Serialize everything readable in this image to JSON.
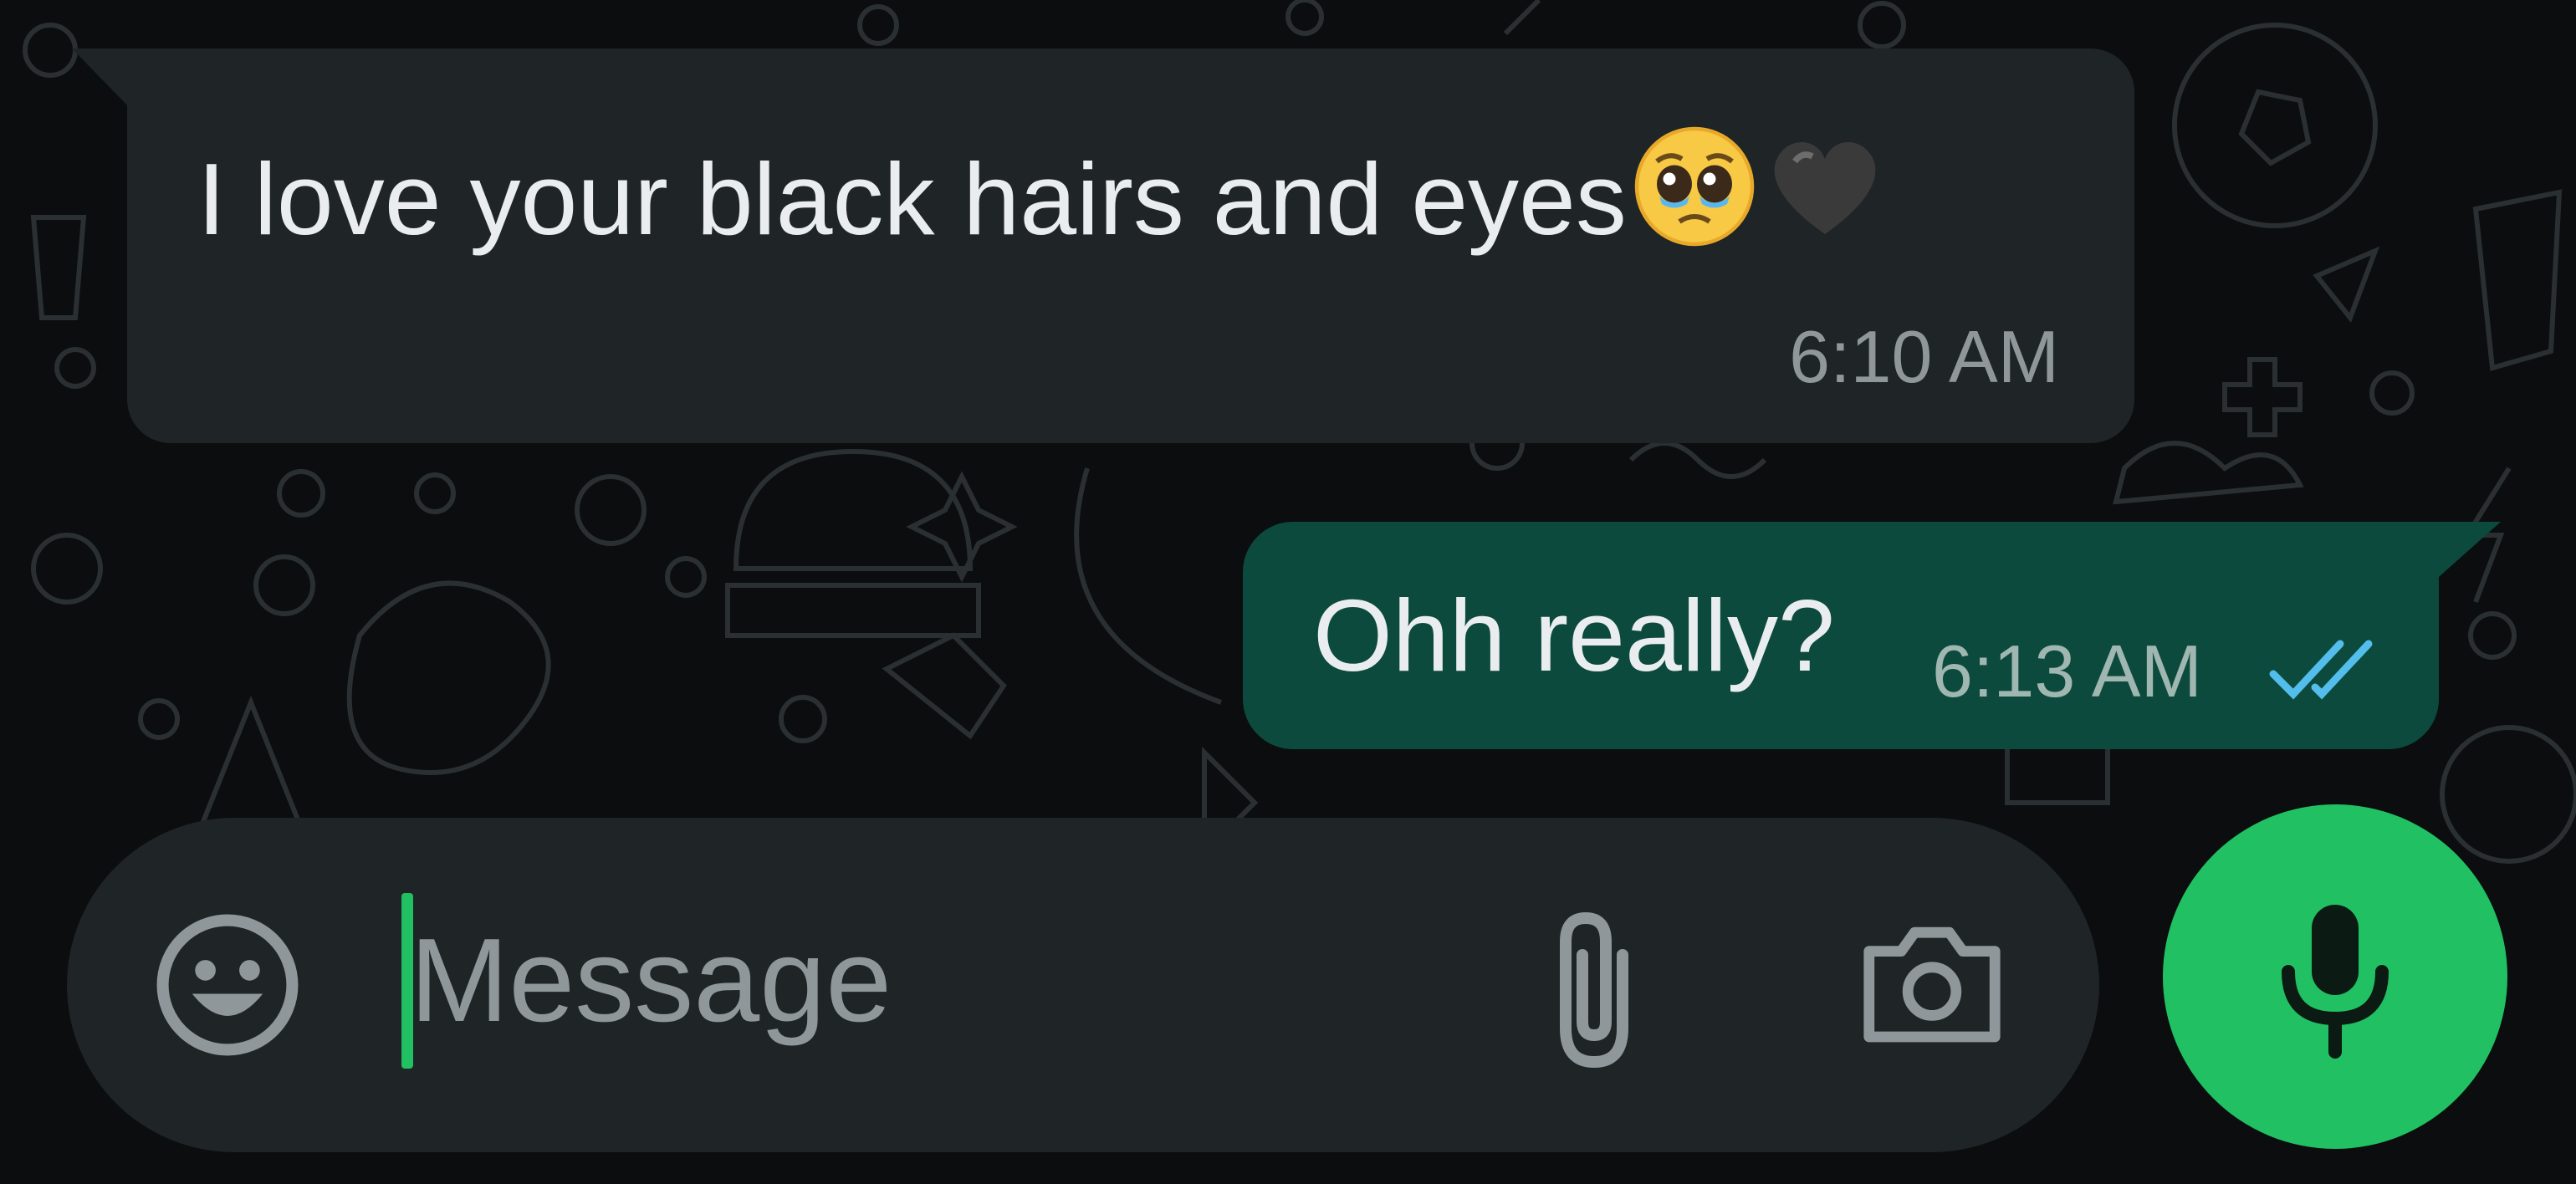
{
  "conversation": {
    "messages": [
      {
        "direction": "incoming",
        "text": "I love your black hairs and eyes",
        "emoji": [
          "pleading-face-with-tears",
          "black-heart"
        ],
        "time": "6:10 AM"
      },
      {
        "direction": "outgoing",
        "text": "Ohh really?",
        "time": "6:13 AM",
        "status": "read"
      }
    ]
  },
  "composer": {
    "placeholder": "Message",
    "value": "",
    "icons": [
      "emoji-icon",
      "attach-icon",
      "camera-icon"
    ]
  },
  "mic_button": {
    "icon": "microphone-icon"
  },
  "colors": {
    "background": "#0b0d0e",
    "incoming_bubble": "#1f2426",
    "outgoing_bubble": "#0c4a3d",
    "accent": "#21c063",
    "read_ticks": "#53bdeb"
  }
}
